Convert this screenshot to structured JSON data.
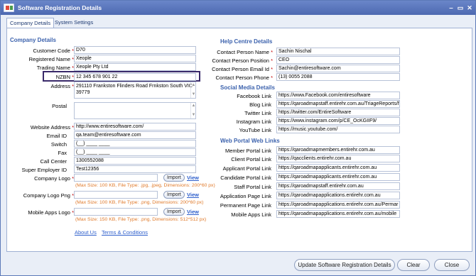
{
  "window": {
    "title": "Software Registration Details",
    "minimize": "‒",
    "maximize": "▭",
    "close": "✕"
  },
  "tabs": [
    "Company Details",
    "System Settings"
  ],
  "company": {
    "section_title": "Company Details",
    "customer_code": {
      "label": "Customer Code",
      "value": "D70"
    },
    "registered_name": {
      "label": "Registered Name",
      "value": "Xeople"
    },
    "trading_name": {
      "label": "Trading Name",
      "value": "Xeople Pty Ltd"
    },
    "nzbn": {
      "label": "NZBN",
      "value": "12 345 678 901 22"
    },
    "address": {
      "label": "Address",
      "value": "291110 Frankston Flinders Road Frnkston South VIC 39779"
    },
    "postal": {
      "label": "Postal",
      "value": ""
    },
    "website": {
      "label": "Website Address",
      "value": "http://www.entiresoftware.com/"
    },
    "email": {
      "label": "Email ID",
      "value": "qa.team@entiresoftware.com"
    },
    "switch": {
      "label": "Switch",
      "value": "(__) ____ ____"
    },
    "fax": {
      "label": "Fax",
      "value": "(__) ____ ____"
    },
    "call_center": {
      "label": "Call Center",
      "value": "1300552088"
    },
    "super_employer": {
      "label": "Super Employer ID",
      "value": "Test12356"
    },
    "company_logo": {
      "label": "Company Logo",
      "hint": "(Max Size: 100 KB, File Type: .jpg, .jpeg, Dimensions: 200*60 px)"
    },
    "company_logo_png": {
      "label": "Company Logo Png",
      "hint": "(Max Size: 100 KB, File Type: .png, Dimensions: 200*60 px)"
    },
    "mobile_logo": {
      "label": "Mobile Apps Logo",
      "hint": "(Max Size: 150 KB, File Type: .png, Dimensions: 512*512 px)"
    },
    "import_label": "Import",
    "view_label": "View",
    "about_us": "About Us",
    "terms": "Terms & Conditions"
  },
  "help": {
    "section_title": "Help Centre Details",
    "contact_name": {
      "label": "Contact Person Name",
      "value": "Sachin Nischal"
    },
    "contact_position": {
      "label": "Contact Person Position",
      "value": "CEO"
    },
    "contact_email": {
      "label": "Contact Person Email Id",
      "value": "Sachin@entiresoftware.com"
    },
    "contact_phone": {
      "label": "Contact Person Phone",
      "value": "(13) 0055 2088"
    }
  },
  "social": {
    "section_title": "Social Media Details",
    "facebook": {
      "label": "Facebook Link",
      "value": "https://www.Facebook.com/entiresoftware"
    },
    "blog": {
      "label": "Blog Link",
      "value": "https://qaroadmapstaff.entirehr.com.au/TriageReports/f"
    },
    "twitter": {
      "label": "Twitter Link",
      "value": "https://twitter.com/EntireSoftware"
    },
    "instagram": {
      "label": "Instagram Link",
      "value": "https://www.instagram.com/p/CE_OcKGIIF9/"
    },
    "youtube": {
      "label": "YouTube Link",
      "value": "https://music.youtube.com/"
    }
  },
  "portal": {
    "section_title": "Web Portal Web Links",
    "member": {
      "label": "Member Portal Link",
      "value": "https://qaroadmapmembers.entirehr.com.au"
    },
    "client": {
      "label": "Client Portal Link",
      "value": "https://qacclients.entirehr.com.au"
    },
    "applicant": {
      "label": "Applicant Portal Link",
      "value": "https://qaroadmapapplicants.entirehr.com.au"
    },
    "candidate": {
      "label": "Candidate Portal Link",
      "value": "https://qaroadmapapplicants.entirehr.com.au"
    },
    "staff": {
      "label": "Staff Portal Link",
      "value": "https://qaroadmapstaff.entirehr.com.au"
    },
    "application": {
      "label": "Application Page Link",
      "value": "https://qaroadmapapplications.entirehr.com.au"
    },
    "permanent": {
      "label": "Permanent Page Link",
      "value": "https://qaroadmapapplications.entirehr.com.au/Permar"
    },
    "mobile": {
      "label": "Mobile Apps Link",
      "value": "https://qaroadmapapplications.entirehr.com.au/mobile"
    }
  },
  "buttons": {
    "update": "Update Software Registration Details",
    "clear": "Clear",
    "close": "Close"
  }
}
